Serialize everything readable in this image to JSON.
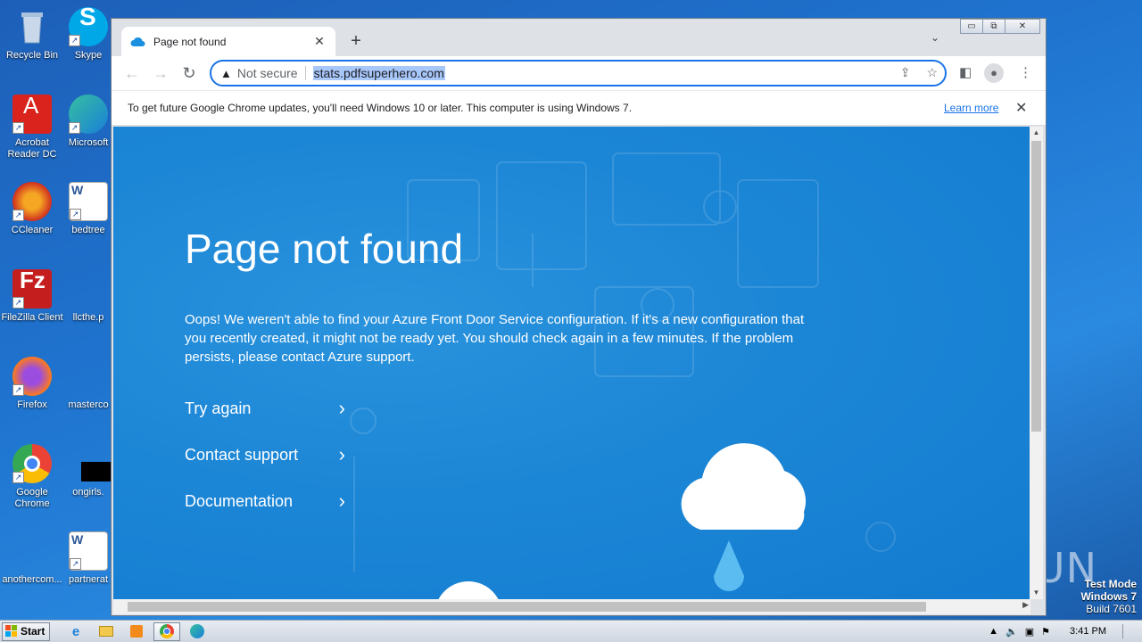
{
  "desktop": {
    "icons": [
      {
        "label": "Recycle Bin"
      },
      {
        "label": "Skype"
      },
      {
        "label": "Acrobat Reader DC"
      },
      {
        "label": "Microsoft"
      },
      {
        "label": "CCleaner"
      },
      {
        "label": "bedtree"
      },
      {
        "label": "FileZilla Client"
      },
      {
        "label": "llcthe.p"
      },
      {
        "label": "Firefox"
      },
      {
        "label": "masterco"
      },
      {
        "label": "Google Chrome"
      },
      {
        "label": "ongirls."
      },
      {
        "label": "anothercom..."
      },
      {
        "label": "partnerat"
      }
    ],
    "watermark": "ANY RUN",
    "test_mode": {
      "line1": "Test Mode",
      "line2": "Windows 7",
      "line3": "Build 7601"
    }
  },
  "browser": {
    "tab": {
      "title": "Page not found",
      "close": "✕"
    },
    "new_tab": "+",
    "tab_search": "⌄",
    "window_controls": {
      "minimize": "▭",
      "maximize": "⧉",
      "close": "✕"
    },
    "nav": {
      "back": "←",
      "forward": "→",
      "reload": "↻"
    },
    "omnibox": {
      "security_label": "Not secure",
      "url": "stats.pdfsuperhero.com"
    },
    "infobar": {
      "message": "To get future Google Chrome updates, you'll need Windows 10 or later. This computer is using Windows 7.",
      "link": "Learn more",
      "close": "✕"
    }
  },
  "page": {
    "heading": "Page not found",
    "body": "Oops! We weren't able to find your Azure Front Door Service configuration. If it's a new configuration that you recently created, it might not be ready yet. You should check again in a few minutes. If the problem persists, please contact Azure support.",
    "actions": [
      {
        "label": "Try again",
        "chevron": "›"
      },
      {
        "label": "Contact support",
        "chevron": "›"
      },
      {
        "label": "Documentation",
        "chevron": "›"
      }
    ]
  },
  "taskbar": {
    "start": "Start",
    "clock": "3:41 PM",
    "tray_up": "▲"
  },
  "colors": {
    "page_bg": "#1c86d6",
    "accent": "#1a73e8",
    "desktop_bg": "#1f74cf"
  }
}
